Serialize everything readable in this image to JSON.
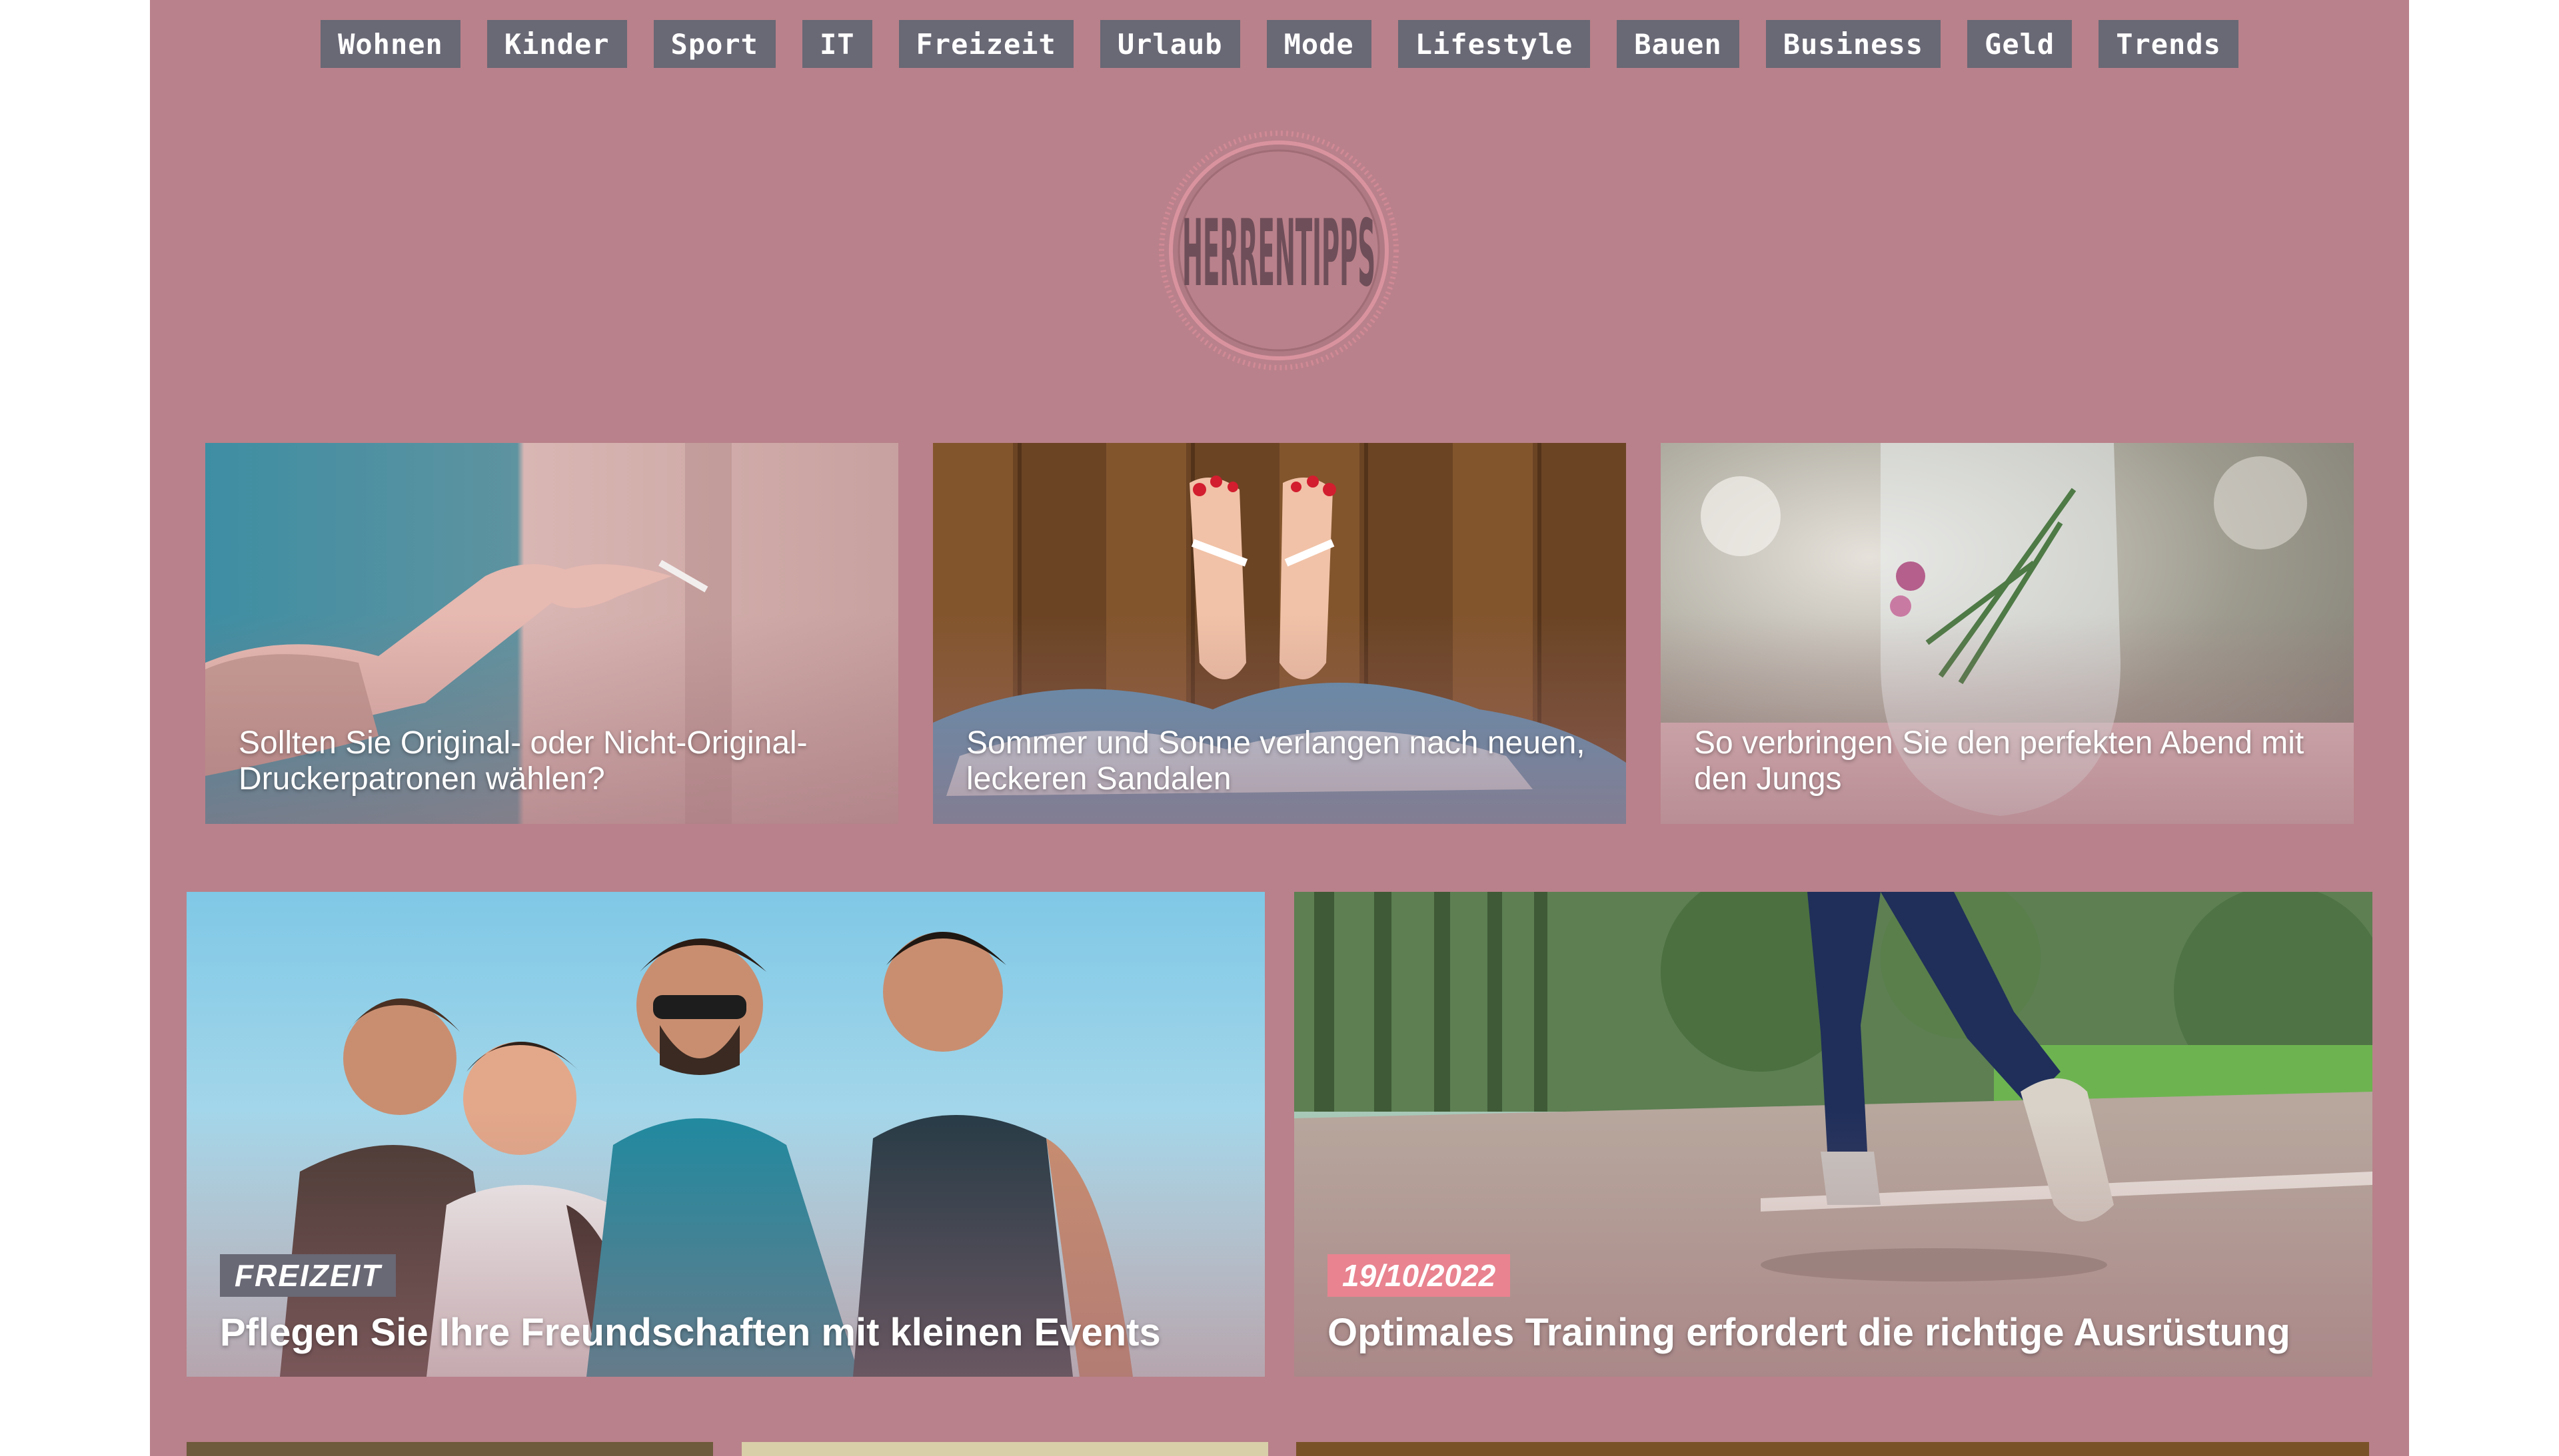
{
  "nav": {
    "items": [
      {
        "label": "Wohnen"
      },
      {
        "label": "Kinder"
      },
      {
        "label": "Sport"
      },
      {
        "label": "IT"
      },
      {
        "label": "Freizeit"
      },
      {
        "label": "Urlaub"
      },
      {
        "label": "Mode"
      },
      {
        "label": "Lifestyle"
      },
      {
        "label": "Bauen"
      },
      {
        "label": "Business"
      },
      {
        "label": "Geld"
      },
      {
        "label": "Trends"
      }
    ]
  },
  "logo": {
    "text": "HERRENTIPPS"
  },
  "featured_small": [
    {
      "title": "Sollten Sie Original- oder Nicht-Original-Druckerpatronen wählen?",
      "image": "hand-holding-cigarette-photo"
    },
    {
      "title": "Sommer und Sonne verlangen nach neuen, leckeren Sandalen",
      "image": "feet-in-sandals-photo"
    },
    {
      "title": "So verbringen Sie den perfekten Abend mit den Jungs",
      "image": "glass-with-rosemary-photo"
    }
  ],
  "featured_big": [
    {
      "badge": "FREIZEIT",
      "title": "Pflegen Sie Ihre Freundschaften mit kleinen Events",
      "image": "group-of-friends-photo"
    },
    {
      "badge": "19/10/2022",
      "title": "Optimales Training erfordert die richtige Ausrüstung",
      "image": "runner-in-park-photo"
    }
  ],
  "colors": {
    "site_background": "#b9818b",
    "nav_background": "#696875",
    "date_badge": "#e8838f",
    "text": "#ffffff"
  }
}
